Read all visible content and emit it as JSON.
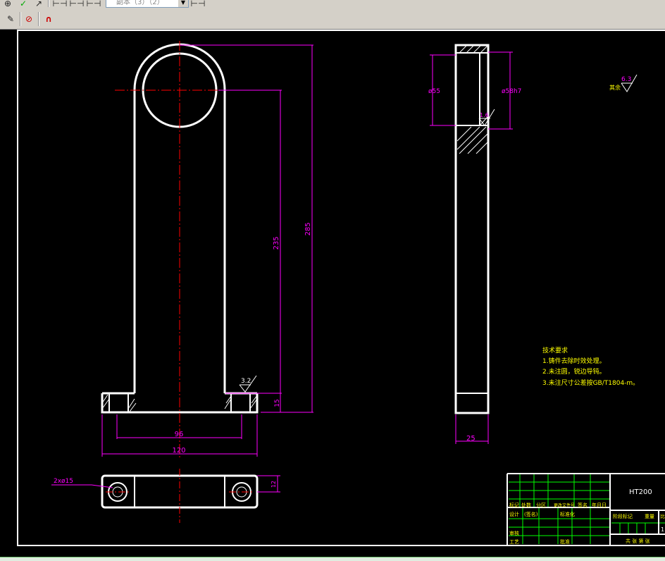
{
  "toolbar": {
    "combo_value": "副本（3）（2）",
    "row1_icons": [
      "circle-plus-icon",
      "check-icon",
      "pointer-arrow-icon",
      "dim-linear-icon",
      "dim-aligned-icon",
      "dim-baseline-icon",
      "dim-continue-icon"
    ],
    "row2_icons": [
      "edit-icon",
      "layer-off-icon",
      "magnet-icon"
    ]
  },
  "drawing": {
    "front": {
      "dim_235": "235",
      "dim_285": "285",
      "dim_15": "15",
      "dim_96": "96",
      "dim_120": "120",
      "roughness_32": "3.2"
    },
    "bottom": {
      "hole_label": "2xø15",
      "dim_12": "12"
    },
    "side": {
      "dim_55": "ø55",
      "dim_58": "ø58h7",
      "roughness_16": "1.6",
      "dim_25": "25"
    },
    "roughness_note": {
      "value": "6.3",
      "label": "其余"
    },
    "tech_req": {
      "title": "技术要求",
      "items": [
        "1.铸件去除时效处理。",
        "2.未注圆，锐边导钝。",
        "3.未注尺寸公差按GB/T1804-m。"
      ]
    },
    "title_block": {
      "material": "HT200",
      "labels_row1": [
        "标记",
        "处数",
        "分区",
        "更改文件号",
        "签名",
        "年月日"
      ],
      "labels_row2": [
        "设计",
        "(签名)",
        "标准化"
      ],
      "labels_right": [
        "阶段标记",
        "重量",
        "比例"
      ],
      "labels_bottom": [
        "审核",
        "工艺",
        "批准"
      ],
      "sheet_text": "共 张 第 张",
      "scale_value": "1"
    }
  },
  "colors": {
    "canvas": "#000000",
    "geometry": "#ffffff",
    "dimension": "#ff00ff",
    "centerline": "#ff0000",
    "annotation": "#ffff00",
    "table_grid": "#00ff00"
  }
}
